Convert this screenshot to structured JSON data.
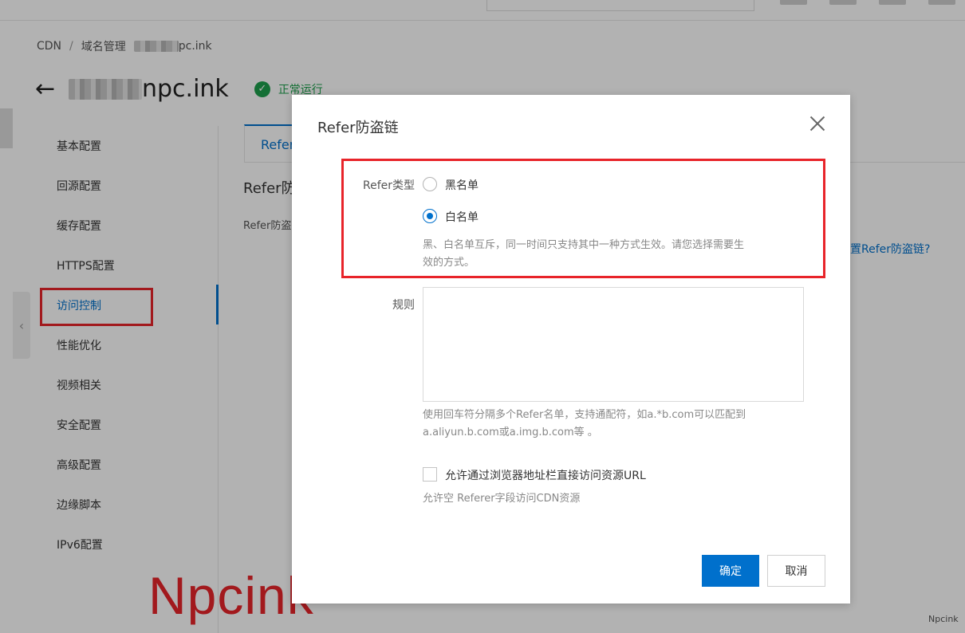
{
  "breadcrumb": {
    "root": "CDN",
    "separator": "/",
    "section": "域名管理",
    "domain_suffix": "pc.ink"
  },
  "page": {
    "back_icon": "←",
    "domain_suffix": "npc.ink",
    "status_icon": "✓",
    "status": "正常运行"
  },
  "sidenav": {
    "items": [
      {
        "label": "基本配置"
      },
      {
        "label": "回源配置"
      },
      {
        "label": "缓存配置"
      },
      {
        "label": "HTTPS配置"
      },
      {
        "label": "访问控制"
      },
      {
        "label": "性能优化"
      },
      {
        "label": "视频相关"
      },
      {
        "label": "安全配置"
      },
      {
        "label": "高级配置"
      },
      {
        "label": "边缘脚本"
      },
      {
        "label": "IPv6配置"
      }
    ]
  },
  "content": {
    "tab_label": "Refer",
    "heading": "Refer防",
    "desc": "Refer防盗",
    "help_link": "置Refer防盗链?"
  },
  "dialog": {
    "title": "Refer防盗链",
    "close_icon": "close-icon",
    "refer_type_label": "Refer类型",
    "options": [
      {
        "label": "黑名单",
        "checked": false
      },
      {
        "label": "白名单",
        "checked": true
      }
    ],
    "type_hint_line1": "黑、白名单互斥，同一时间只支持其中一种方式生效。请您选择需要生",
    "type_hint_line2": "效的方式。",
    "rules_label": "规则",
    "rules_value": "",
    "rules_hint_line1": "使用回车符分隔多个Refer名单，支持通配符，如a.*b.com可以匹配到",
    "rules_hint_line2": "a.aliyun.b.com或a.img.b.com等 。",
    "allow_checkbox_label": "允许通过浏览器地址栏直接访问资源URL",
    "allow_checkbox_checked": false,
    "allow_hint": "允许空 Referer字段访问CDN资源",
    "confirm": "确定",
    "cancel": "取消"
  },
  "watermark": {
    "big": "Npcink",
    "small": "Npcink"
  },
  "colors": {
    "primary": "#0070cc",
    "success": "#1e9f4c",
    "highlight": "#e8242a"
  }
}
